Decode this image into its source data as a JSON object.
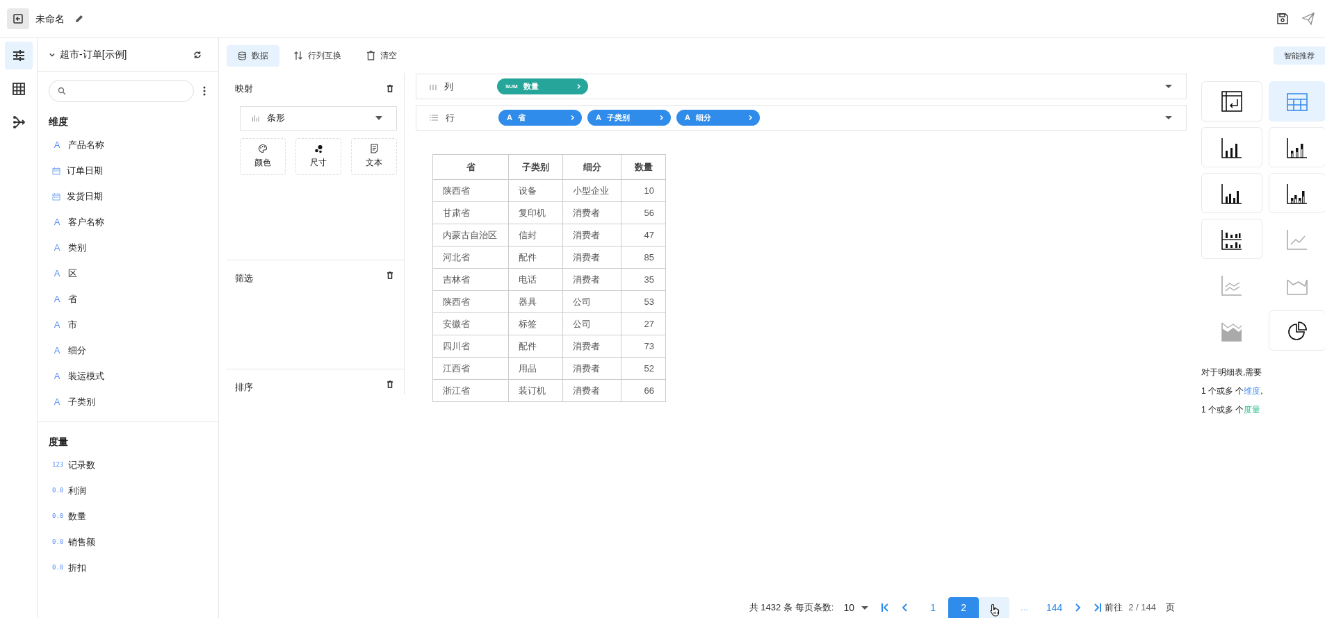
{
  "header": {
    "title": "未命名"
  },
  "rail": [
    {
      "kind": "settings",
      "selected": true
    },
    {
      "kind": "table",
      "selected": false
    },
    {
      "kind": "flow",
      "selected": false
    }
  ],
  "sidebar": {
    "dataset": "超市-订单[示例]",
    "sections": [
      {
        "title": "维度",
        "fields": [
          {
            "kind": "text",
            "badge": "A",
            "name": "产品名称"
          },
          {
            "kind": "date",
            "name": "订单日期"
          },
          {
            "kind": "date",
            "name": "发货日期"
          },
          {
            "kind": "text",
            "badge": "A",
            "name": "客户名称"
          },
          {
            "kind": "text",
            "badge": "A",
            "name": "类别"
          },
          {
            "kind": "text",
            "badge": "A",
            "name": "区"
          },
          {
            "kind": "text",
            "badge": "A",
            "name": "省"
          },
          {
            "kind": "text",
            "badge": "A",
            "name": "市"
          },
          {
            "kind": "text",
            "badge": "A",
            "name": "细分"
          },
          {
            "kind": "text",
            "badge": "A",
            "name": "装运模式"
          },
          {
            "kind": "text",
            "badge": "A",
            "name": "子类别"
          }
        ]
      },
      {
        "title": "度量",
        "fields": [
          {
            "kind": "number",
            "badge": "123",
            "name": "记录数"
          },
          {
            "kind": "number",
            "badge": "0.0",
            "name": "利润"
          },
          {
            "kind": "number",
            "badge": "0.0",
            "name": "数量"
          },
          {
            "kind": "number",
            "badge": "0.0",
            "name": "销售额"
          },
          {
            "kind": "number",
            "badge": "0.0",
            "name": "折扣"
          }
        ]
      }
    ]
  },
  "toolbar": [
    {
      "kind": "data",
      "label": "数据",
      "selected": true
    },
    {
      "kind": "swap",
      "label": "行列互换",
      "selected": false
    },
    {
      "kind": "clear",
      "label": "清空",
      "selected": false
    }
  ],
  "config": {
    "mapping": {
      "title": "映射",
      "chart_select": "条形",
      "channels": [
        {
          "kind": "color",
          "label": "颜色"
        },
        {
          "kind": "size",
          "label": "尺寸"
        },
        {
          "kind": "text",
          "label": "文本"
        }
      ]
    },
    "filter": {
      "title": "筛选"
    },
    "sort": {
      "title": "排序"
    }
  },
  "shelves": [
    {
      "kind": "columns",
      "label": "列",
      "pills": [
        {
          "kind": "measure",
          "prefix": "SUM",
          "name": "数量"
        }
      ]
    },
    {
      "kind": "rows",
      "label": "行",
      "pills": [
        {
          "kind": "dimension",
          "prefix": "A",
          "name": "省"
        },
        {
          "kind": "dimension",
          "prefix": "A",
          "name": "子类别"
        },
        {
          "kind": "dimension",
          "prefix": "A",
          "name": "细分"
        }
      ]
    }
  ],
  "table": {
    "columns": [
      "省",
      "子类别",
      "细分",
      "数量"
    ],
    "rows": [
      [
        "陕西省",
        "设备",
        "小型企业",
        "10"
      ],
      [
        "甘肃省",
        "复印机",
        "消费者",
        "56"
      ],
      [
        "内蒙古自治区",
        "信封",
        "消费者",
        "47"
      ],
      [
        "河北省",
        "配件",
        "消费者",
        "85"
      ],
      [
        "吉林省",
        "电话",
        "消费者",
        "35"
      ],
      [
        "陕西省",
        "器具",
        "公司",
        "53"
      ],
      [
        "安徽省",
        "标签",
        "公司",
        "27"
      ],
      [
        "四川省",
        "配件",
        "消费者",
        "73"
      ],
      [
        "江西省",
        "用品",
        "消费者",
        "52"
      ],
      [
        "浙江省",
        "装订机",
        "消费者",
        "66"
      ]
    ]
  },
  "pagination": {
    "total": "共 1432 条",
    "page_size_label": "每页条数:",
    "page_size": "10",
    "pages": [
      {
        "label": "1",
        "selected": false,
        "hovered": false
      },
      {
        "label": "2",
        "selected": true,
        "hovered": false
      },
      {
        "selected": false,
        "hovered": true
      }
    ],
    "ellipsis": "...",
    "last_page": "144",
    "goto_label": "前往",
    "goto_value": "2 / 144",
    "goto_unit": "页"
  },
  "recommend": {
    "button": "智能推荐",
    "chart_types": [
      {
        "kind": "pivot",
        "available": true,
        "selected": false
      },
      {
        "kind": "table",
        "available": true,
        "selected": true
      },
      {
        "kind": "bar",
        "available": true,
        "selected": false
      },
      {
        "kind": "bar-outline",
        "available": true,
        "selected": false
      },
      {
        "kind": "bar-grouped",
        "available": true,
        "selected": false
      },
      {
        "kind": "bar-stacked",
        "available": true,
        "selected": false
      },
      {
        "kind": "bar-multi",
        "available": true,
        "selected": false
      },
      {
        "kind": "line",
        "available": false,
        "selected": false
      },
      {
        "kind": "line-multi",
        "available": false,
        "selected": false
      },
      {
        "kind": "area",
        "available": false,
        "selected": false
      },
      {
        "kind": "area-filled",
        "available": false,
        "selected": false
      },
      {
        "kind": "pie",
        "available": true,
        "selected": false
      }
    ],
    "hint": [
      {
        "text": "对于明细表,需要"
      },
      {
        "text": "1 个或多 个",
        "term": {
          "text": "维度",
          "color": "#4a8ff0"
        },
        "tail": ","
      },
      {
        "text": "1 个或多 个",
        "term": {
          "text": "度量",
          "color": "#2ec08a"
        }
      }
    ]
  }
}
